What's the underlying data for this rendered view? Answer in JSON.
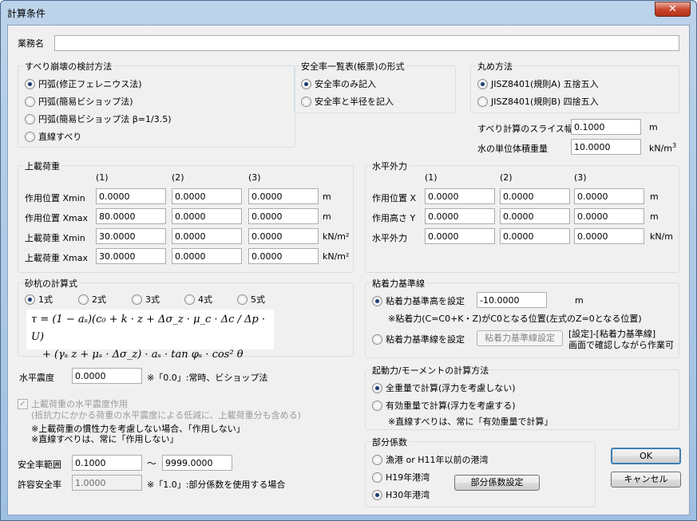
{
  "window": {
    "title": "計算条件",
    "close": "✕"
  },
  "gyomu": {
    "label": "業務名",
    "value": ""
  },
  "suberi": {
    "title": "すべり崩壊の検討方法",
    "options": [
      "円弧(修正フェレニウス法)",
      "円弧(簡易ビショップ法)",
      "円弧(簡易ビショップ法 β=1/3.5)",
      "直線すべり"
    ],
    "selected": 0
  },
  "anzen_ichiran": {
    "title": "安全率一覧表(帳票)の形式",
    "options": [
      "安全率のみ記入",
      "安全率と半径を記入"
    ],
    "selected": 0
  },
  "marume": {
    "title": "丸め方法",
    "options": [
      "JISZ8401(規則A) 五捨五入",
      "JISZ8401(規則B) 四捨五入"
    ],
    "selected": 0
  },
  "slice": {
    "label": "すべり計算のスライス幅",
    "value": "0.1000",
    "unit": "m"
  },
  "mizu": {
    "label": "水の単位体積重量",
    "value": "10.0000",
    "unit": "kN/m",
    "unit_sup": "3"
  },
  "josai": {
    "title": "上載荷重",
    "headers": [
      "(1)",
      "(2)",
      "(3)"
    ],
    "rows": [
      {
        "label": "作用位置 Xmin",
        "values": [
          "0.0000",
          "0.0000",
          "0.0000"
        ],
        "unit": "m"
      },
      {
        "label": "作用位置 Xmax",
        "values": [
          "80.0000",
          "0.0000",
          "0.0000"
        ],
        "unit": "m"
      },
      {
        "label": "上載荷重 Xmin",
        "values": [
          "30.0000",
          "0.0000",
          "0.0000"
        ],
        "unit": "kN/m²"
      },
      {
        "label": "上載荷重 Xmax",
        "values": [
          "30.0000",
          "0.0000",
          "0.0000"
        ],
        "unit": "kN/m²"
      }
    ]
  },
  "suihei_gairyoku": {
    "title": "水平外力",
    "headers": [
      "(1)",
      "(2)",
      "(3)"
    ],
    "rows": [
      {
        "label": "作用位置 X",
        "values": [
          "0.0000",
          "0.0000",
          "0.0000"
        ],
        "unit": "m"
      },
      {
        "label": "作用高さ Y",
        "values": [
          "0.0000",
          "0.0000",
          "0.0000"
        ],
        "unit": "m"
      },
      {
        "label": "水平外力",
        "values": [
          "0.0000",
          "0.0000",
          "0.0000"
        ],
        "unit": "kN/m"
      }
    ]
  },
  "sagui": {
    "title": "砂杭の計算式",
    "options": [
      "1式",
      "2式",
      "3式",
      "4式",
      "5式"
    ],
    "selected": 0,
    "formula_line1": "τ = (1 − aₛ)(c₀ + k · z + Δσ_z · μ_c · Δc / Δp · U)",
    "formula_line2": "+ (γₛ z + μₛ · Δσ_z) · aₛ · tan φₛ · cos² θ"
  },
  "nenchaku": {
    "title": "粘着力基準線",
    "opt1": "粘着力基準高を設定",
    "opt1_value": "-10.0000",
    "opt1_unit": "m",
    "note1": "※粘着力(C=C0+K・Z)がC0となる位置(左式のZ=0となる位置)",
    "opt2": "粘着力基準線を設定",
    "opt2_button": "粘着力基準線設定",
    "note2a": "[設定]-[粘着力基準線]",
    "note2b": "画面で確認しながら作業可",
    "selected": 0
  },
  "suihei_shindo": {
    "label": "水平震度",
    "value": "0.0000",
    "note": "※「0.0」:常時、ビショップ法"
  },
  "kidoryoku": {
    "title": "起動力/モーメントの計算方法",
    "options": [
      "全重量で計算(浮力を考慮しない)",
      "有効重量で計算(浮力を考慮する)"
    ],
    "selected": 0,
    "note": "※直線すべりは、常に「有効重量で計算」"
  },
  "josai_shindo": {
    "check": "✓",
    "label1": "上載荷重の水平震度作用",
    "label2": "(抵抗力にかかる荷重の水平震度による低減に、上載荷重分も含める)",
    "note1": "※上載荷重の慣性力を考慮しない場合、「作用しない」",
    "note2": "※直線すべりは、常に「作用しない」"
  },
  "anzenritsu": {
    "label": "安全率範囲",
    "min": "0.1000",
    "tilde": "〜",
    "max": "9999.0000"
  },
  "kyoyo": {
    "label": "許容安全率",
    "value": "1.0000",
    "note": "※「1.0」:部分係数を使用する場合"
  },
  "bubun": {
    "title": "部分係数",
    "options": [
      "漁港 or H11年以前の港湾",
      "H19年港湾",
      "H30年港湾"
    ],
    "selected": 2,
    "button": "部分係数設定"
  },
  "buttons": {
    "ok": "OK",
    "cancel": "キャンセル"
  }
}
